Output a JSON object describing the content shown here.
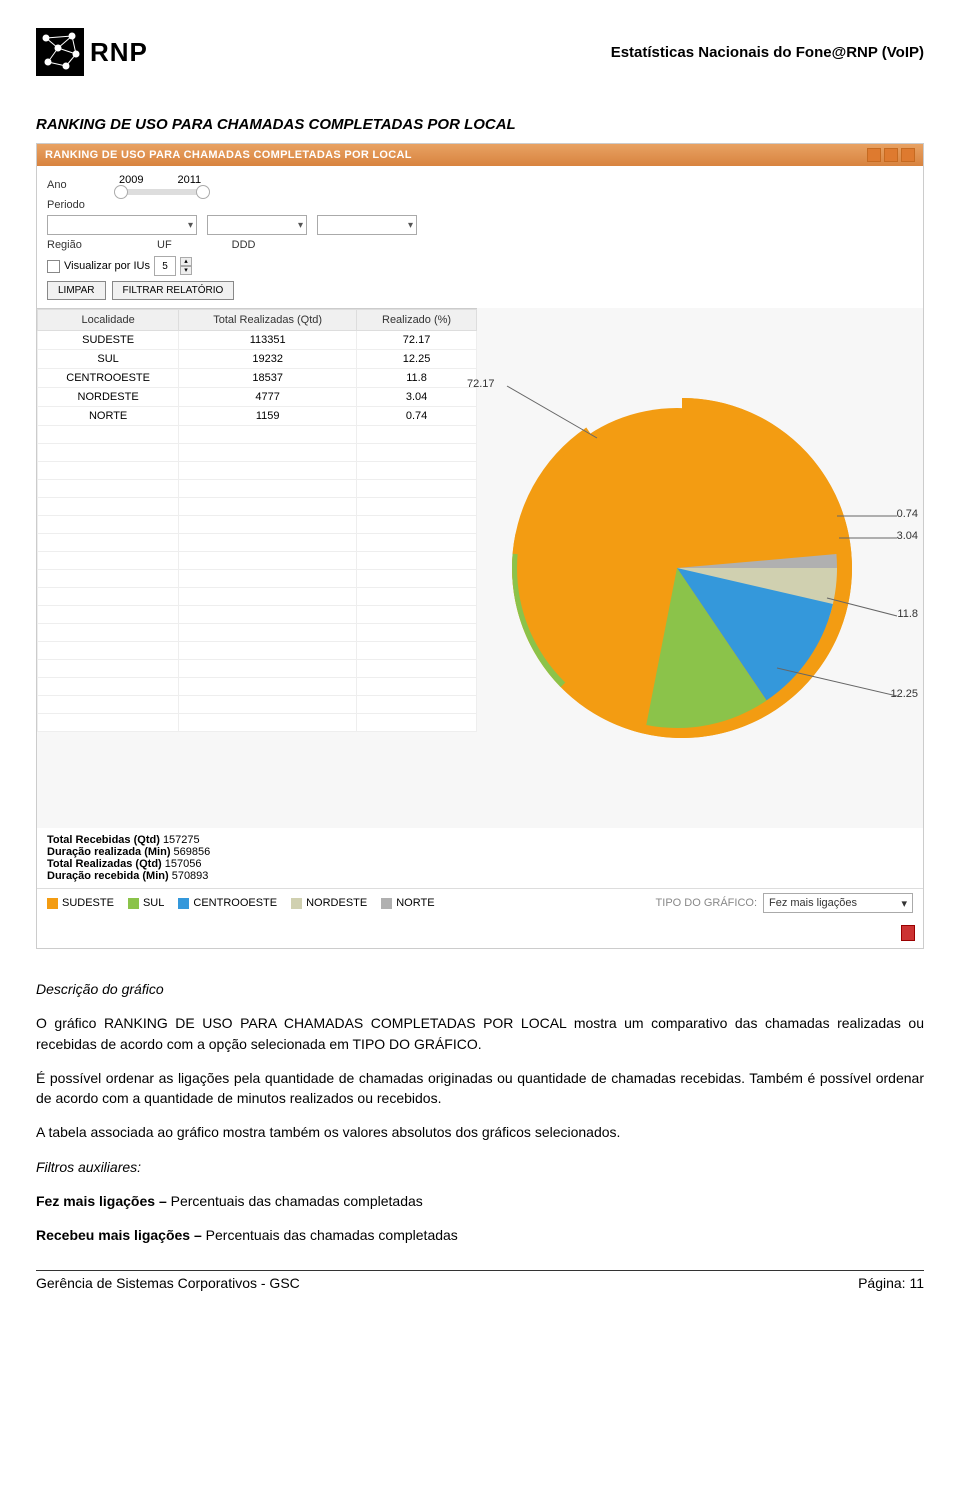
{
  "header": {
    "logo_text": "RNP",
    "title": "Estatísticas Nacionais do Fone@RNP (VoIP)"
  },
  "section": {
    "title": "RANKING DE USO PARA CHAMADAS COMPLETADAS POR LOCAL"
  },
  "panel": {
    "title": "RANKING DE USO PARA CHAMADAS COMPLETADAS POR LOCAL"
  },
  "controls": {
    "ano_label": "Ano",
    "year_min": "2009",
    "year_max": "2011",
    "periodo_label": "Periodo",
    "regiao_label": "Região",
    "uf_label": "UF",
    "ddd_label": "DDD",
    "visualizar_ius": "Visualizar por IUs",
    "ius_value": "5",
    "limpar": "LIMPAR",
    "filtrar": "FILTRAR RELATÓRIO"
  },
  "table": {
    "headers": [
      "Localidade",
      "Total Realizadas (Qtd)",
      "Realizado (%)"
    ],
    "rows": [
      {
        "loc": "SUDESTE",
        "qtd": "113351",
        "pct": "72.17"
      },
      {
        "loc": "SUL",
        "qtd": "19232",
        "pct": "12.25"
      },
      {
        "loc": "CENTROOESTE",
        "qtd": "18537",
        "pct": "11.8"
      },
      {
        "loc": "NORDESTE",
        "qtd": "4777",
        "pct": "3.04"
      },
      {
        "loc": "NORTE",
        "qtd": "1159",
        "pct": "0.74"
      }
    ]
  },
  "chart_data": {
    "type": "pie",
    "categories": [
      "SUDESTE",
      "SUL",
      "CENTROOESTE",
      "NORDESTE",
      "NORTE"
    ],
    "values": [
      72.17,
      12.25,
      11.8,
      3.04,
      0.74
    ],
    "colors": [
      "#f39c12",
      "#8bc34a",
      "#3498db",
      "#d0d0b0",
      "#b0b0b0"
    ],
    "title": "Ranking de uso para chamadas completadas por local",
    "unit": "%"
  },
  "totals": {
    "recebidas_qtd_label": "Total Recebidas (Qtd)",
    "recebidas_qtd": "157275",
    "duracao_realizada_label": "Duração realizada (Min)",
    "duracao_realizada": "569856",
    "realizadas_qtd_label": "Total Realizadas (Qtd)",
    "realizadas_qtd": "157056",
    "duracao_recebida_label": "Duração recebida (Min)",
    "duracao_recebida": "570893"
  },
  "legend": {
    "items": [
      "SUDESTE",
      "SUL",
      "CENTROOESTE",
      "NORDESTE",
      "NORTE"
    ],
    "tipo_label": "TIPO DO GRÁFICO:",
    "tipo_value": "Fez mais ligações"
  },
  "narrative": {
    "desc_heading": "Descrição do gráfico",
    "p1": "O gráfico RANKING DE USO PARA CHAMADAS COMPLETADAS POR LOCAL mostra um comparativo das chamadas realizadas ou recebidas de acordo com a opção selecionada em TIPO DO GRÁFICO.",
    "p2": "É possível ordenar as ligações pela quantidade de chamadas originadas ou quantidade de chamadas recebidas. Também é possível ordenar de acordo com a quantidade de minutos realizados ou recebidos.",
    "p3": "A tabela associada ao gráfico mostra também os valores absolutos dos gráficos selecionados.",
    "filtros_heading": "Filtros auxiliares:",
    "filter1_b": "Fez mais ligações –",
    "filter1_t": "Percentuais das chamadas completadas",
    "filter2_b": "Recebeu mais ligações –",
    "filter2_t": "Percentuais das chamadas completadas"
  },
  "footer": {
    "left": "Gerência de Sistemas Corporativos - GSC",
    "right": "Página: 11"
  }
}
